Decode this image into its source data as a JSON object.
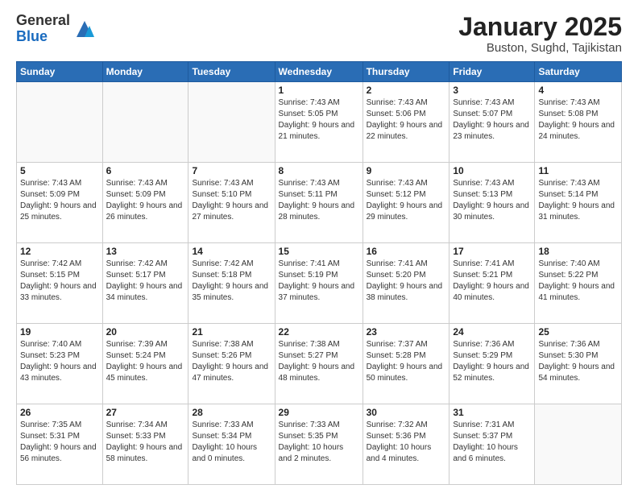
{
  "header": {
    "logo_general": "General",
    "logo_blue": "Blue",
    "month_title": "January 2025",
    "location": "Buston, Sughd, Tajikistan"
  },
  "days_of_week": [
    "Sunday",
    "Monday",
    "Tuesday",
    "Wednesday",
    "Thursday",
    "Friday",
    "Saturday"
  ],
  "weeks": [
    [
      {
        "day": "",
        "info": ""
      },
      {
        "day": "",
        "info": ""
      },
      {
        "day": "",
        "info": ""
      },
      {
        "day": "1",
        "info": "Sunrise: 7:43 AM\nSunset: 5:05 PM\nDaylight: 9 hours and 21 minutes."
      },
      {
        "day": "2",
        "info": "Sunrise: 7:43 AM\nSunset: 5:06 PM\nDaylight: 9 hours and 22 minutes."
      },
      {
        "day": "3",
        "info": "Sunrise: 7:43 AM\nSunset: 5:07 PM\nDaylight: 9 hours and 23 minutes."
      },
      {
        "day": "4",
        "info": "Sunrise: 7:43 AM\nSunset: 5:08 PM\nDaylight: 9 hours and 24 minutes."
      }
    ],
    [
      {
        "day": "5",
        "info": "Sunrise: 7:43 AM\nSunset: 5:09 PM\nDaylight: 9 hours and 25 minutes."
      },
      {
        "day": "6",
        "info": "Sunrise: 7:43 AM\nSunset: 5:09 PM\nDaylight: 9 hours and 26 minutes."
      },
      {
        "day": "7",
        "info": "Sunrise: 7:43 AM\nSunset: 5:10 PM\nDaylight: 9 hours and 27 minutes."
      },
      {
        "day": "8",
        "info": "Sunrise: 7:43 AM\nSunset: 5:11 PM\nDaylight: 9 hours and 28 minutes."
      },
      {
        "day": "9",
        "info": "Sunrise: 7:43 AM\nSunset: 5:12 PM\nDaylight: 9 hours and 29 minutes."
      },
      {
        "day": "10",
        "info": "Sunrise: 7:43 AM\nSunset: 5:13 PM\nDaylight: 9 hours and 30 minutes."
      },
      {
        "day": "11",
        "info": "Sunrise: 7:43 AM\nSunset: 5:14 PM\nDaylight: 9 hours and 31 minutes."
      }
    ],
    [
      {
        "day": "12",
        "info": "Sunrise: 7:42 AM\nSunset: 5:15 PM\nDaylight: 9 hours and 33 minutes."
      },
      {
        "day": "13",
        "info": "Sunrise: 7:42 AM\nSunset: 5:17 PM\nDaylight: 9 hours and 34 minutes."
      },
      {
        "day": "14",
        "info": "Sunrise: 7:42 AM\nSunset: 5:18 PM\nDaylight: 9 hours and 35 minutes."
      },
      {
        "day": "15",
        "info": "Sunrise: 7:41 AM\nSunset: 5:19 PM\nDaylight: 9 hours and 37 minutes."
      },
      {
        "day": "16",
        "info": "Sunrise: 7:41 AM\nSunset: 5:20 PM\nDaylight: 9 hours and 38 minutes."
      },
      {
        "day": "17",
        "info": "Sunrise: 7:41 AM\nSunset: 5:21 PM\nDaylight: 9 hours and 40 minutes."
      },
      {
        "day": "18",
        "info": "Sunrise: 7:40 AM\nSunset: 5:22 PM\nDaylight: 9 hours and 41 minutes."
      }
    ],
    [
      {
        "day": "19",
        "info": "Sunrise: 7:40 AM\nSunset: 5:23 PM\nDaylight: 9 hours and 43 minutes."
      },
      {
        "day": "20",
        "info": "Sunrise: 7:39 AM\nSunset: 5:24 PM\nDaylight: 9 hours and 45 minutes."
      },
      {
        "day": "21",
        "info": "Sunrise: 7:38 AM\nSunset: 5:26 PM\nDaylight: 9 hours and 47 minutes."
      },
      {
        "day": "22",
        "info": "Sunrise: 7:38 AM\nSunset: 5:27 PM\nDaylight: 9 hours and 48 minutes."
      },
      {
        "day": "23",
        "info": "Sunrise: 7:37 AM\nSunset: 5:28 PM\nDaylight: 9 hours and 50 minutes."
      },
      {
        "day": "24",
        "info": "Sunrise: 7:36 AM\nSunset: 5:29 PM\nDaylight: 9 hours and 52 minutes."
      },
      {
        "day": "25",
        "info": "Sunrise: 7:36 AM\nSunset: 5:30 PM\nDaylight: 9 hours and 54 minutes."
      }
    ],
    [
      {
        "day": "26",
        "info": "Sunrise: 7:35 AM\nSunset: 5:31 PM\nDaylight: 9 hours and 56 minutes."
      },
      {
        "day": "27",
        "info": "Sunrise: 7:34 AM\nSunset: 5:33 PM\nDaylight: 9 hours and 58 minutes."
      },
      {
        "day": "28",
        "info": "Sunrise: 7:33 AM\nSunset: 5:34 PM\nDaylight: 10 hours and 0 minutes."
      },
      {
        "day": "29",
        "info": "Sunrise: 7:33 AM\nSunset: 5:35 PM\nDaylight: 10 hours and 2 minutes."
      },
      {
        "day": "30",
        "info": "Sunrise: 7:32 AM\nSunset: 5:36 PM\nDaylight: 10 hours and 4 minutes."
      },
      {
        "day": "31",
        "info": "Sunrise: 7:31 AM\nSunset: 5:37 PM\nDaylight: 10 hours and 6 minutes."
      },
      {
        "day": "",
        "info": ""
      }
    ]
  ]
}
